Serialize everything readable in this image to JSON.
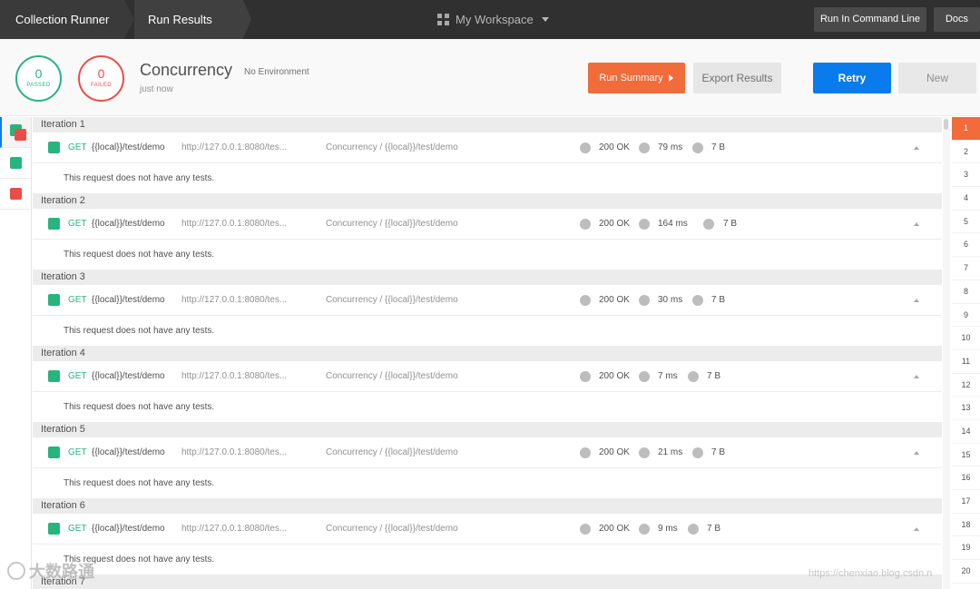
{
  "topbar": {
    "breadcrumb_collection": "Collection Runner",
    "breadcrumb_results": "Run Results",
    "workspace": "My Workspace",
    "run_cmd_label": "Run In Command Line",
    "docs_label": "Docs"
  },
  "summary": {
    "passed_count": "0",
    "passed_label": "PASSED",
    "failed_count": "0",
    "failed_label": "FAILED",
    "name": "Concurrency",
    "environment": "No Environment",
    "time": "just now",
    "run_summary_label": "Run Summary",
    "export_label": "Export Results",
    "retry_label": "Retry",
    "new_label": "New"
  },
  "filters": [
    "all",
    "passed",
    "failed"
  ],
  "iterations": [
    {
      "label": "Iteration 1",
      "method": "GET",
      "name": "{{local}}/test/demo",
      "url": "http://127.0.0.1:8080/tes...",
      "path": "Concurrency / {{local}}/test/demo",
      "status": "200 OK",
      "time": "79 ms",
      "size": "7 B",
      "tests": "This request does not have any tests."
    },
    {
      "label": "Iteration 2",
      "method": "GET",
      "name": "{{local}}/test/demo",
      "url": "http://127.0.0.1:8080/tes...",
      "path": "Concurrency / {{local}}/test/demo",
      "status": "200 OK",
      "time": "164 ms",
      "size": "7 B",
      "tests": "This request does not have any tests."
    },
    {
      "label": "Iteration 3",
      "method": "GET",
      "name": "{{local}}/test/demo",
      "url": "http://127.0.0.1:8080/tes...",
      "path": "Concurrency / {{local}}/test/demo",
      "status": "200 OK",
      "time": "30 ms",
      "size": "7 B",
      "tests": "This request does not have any tests."
    },
    {
      "label": "Iteration 4",
      "method": "GET",
      "name": "{{local}}/test/demo",
      "url": "http://127.0.0.1:8080/tes...",
      "path": "Concurrency / {{local}}/test/demo",
      "status": "200 OK",
      "time": "7 ms",
      "size": "7 B",
      "tests": "This request does not have any tests."
    },
    {
      "label": "Iteration 5",
      "method": "GET",
      "name": "{{local}}/test/demo",
      "url": "http://127.0.0.1:8080/tes...",
      "path": "Concurrency / {{local}}/test/demo",
      "status": "200 OK",
      "time": "21 ms",
      "size": "7 B",
      "tests": "This request does not have any tests."
    },
    {
      "label": "Iteration 6",
      "method": "GET",
      "name": "{{local}}/test/demo",
      "url": "http://127.0.0.1:8080/tes...",
      "path": "Concurrency / {{local}}/test/demo",
      "status": "200 OK",
      "time": "9 ms",
      "size": "7 B",
      "tests": "This request does not have any tests."
    },
    {
      "label": "Iteration 7"
    }
  ],
  "iteration_numbers": [
    "1",
    "2",
    "3",
    "4",
    "5",
    "6",
    "7",
    "8",
    "9",
    "10",
    "11",
    "12",
    "13",
    "14",
    "15",
    "16",
    "17",
    "18",
    "19",
    "20"
  ],
  "active_iteration": "1",
  "watermark": {
    "left": "大数路通",
    "right": "https://chenxiao.blog.csdn.n"
  },
  "colors": {
    "pass": "#26b47f",
    "fail": "#ed4b48",
    "accent_orange": "#f26b3a",
    "accent_blue": "#097bed",
    "topbar": "#303030"
  },
  "icons": {
    "workspace": "grid-icon",
    "workspace_caret": "chevron-down-icon",
    "run_summary": "chevron-right-icon",
    "row_toggle": "chevron-up-icon",
    "status_dot": "circle-icon"
  }
}
